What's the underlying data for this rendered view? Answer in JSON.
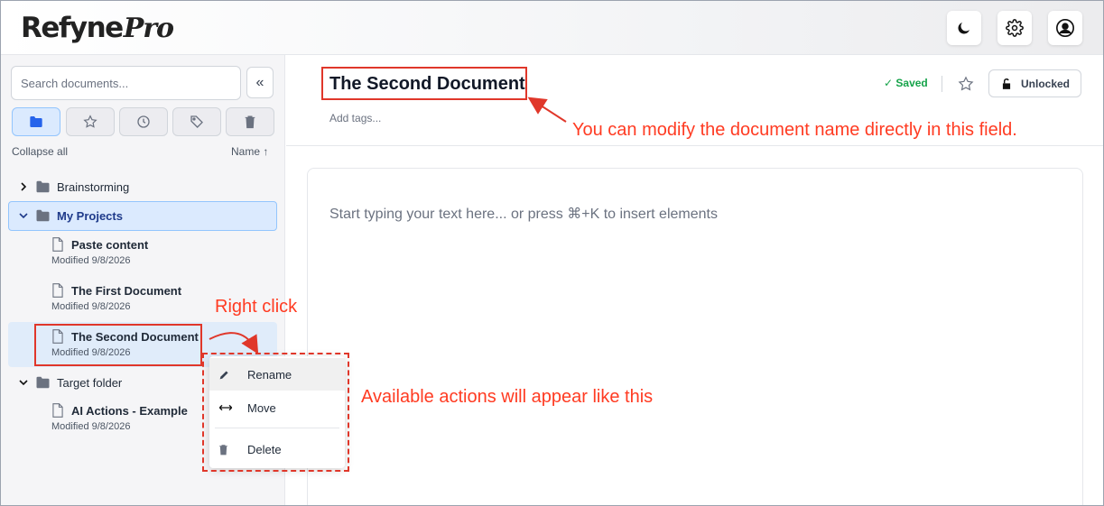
{
  "app": {
    "logo_main": "Refyne",
    "logo_pro": "Pro"
  },
  "header": {
    "icons": [
      "moon-icon",
      "gear-icon",
      "user-icon"
    ]
  },
  "sidebar": {
    "search_placeholder": "Search documents...",
    "collapse_symbol": "«",
    "filters": [
      "folder-icon",
      "star-icon",
      "clock-icon",
      "tag-icon",
      "trash-icon"
    ],
    "collapse_all": "Collapse all",
    "sort_label": "Name ↑",
    "tree": {
      "folder1": {
        "name": "Brainstorming"
      },
      "folder2": {
        "name": "My Projects",
        "docs": [
          {
            "title": "Paste content",
            "modified": "Modified 9/8/2026"
          },
          {
            "title": "The First Document",
            "modified": "Modified 9/8/2026"
          },
          {
            "title": "The Second Document",
            "modified": "Modified 9/8/2026"
          }
        ]
      },
      "folder3": {
        "name": "Target folder",
        "docs": [
          {
            "title": "AI Actions - Example",
            "modified": "Modified 9/8/2026"
          }
        ]
      }
    }
  },
  "context_menu": {
    "items": [
      {
        "label": "Rename",
        "icon": "pencil-icon"
      },
      {
        "label": "Move",
        "icon": "arrows-horizontal-icon"
      },
      {
        "label": "Delete",
        "icon": "trash-icon"
      }
    ]
  },
  "document": {
    "title": "The Second Document",
    "tags_placeholder": "Add tags...",
    "saved_status": "✓ Saved",
    "lock_label": "Unlocked",
    "editor_placeholder": "Start typing your text here... or press ⌘+K to insert elements"
  },
  "annotations": {
    "title_hint": "You can modify the document name directly in this field.",
    "right_click": "Right click",
    "actions_hint": "Available actions will appear like this"
  },
  "colors": {
    "accent": "#2563eb",
    "selection_bg": "#dbeafe",
    "saved_green": "#16a34a",
    "annotation_red": "#ff3b22"
  }
}
